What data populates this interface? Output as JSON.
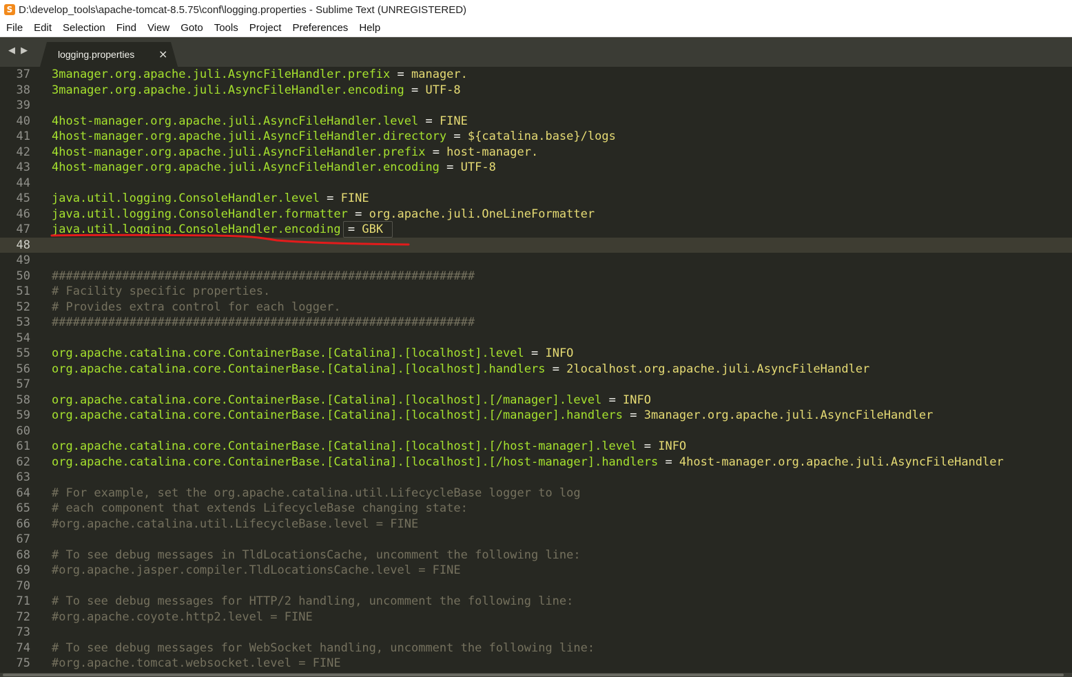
{
  "window": {
    "title": "D:\\develop_tools\\apache-tomcat-8.5.75\\conf\\logging.properties - Sublime Text (UNREGISTERED)",
    "app_icon": "S"
  },
  "menu": [
    "File",
    "Edit",
    "Selection",
    "Find",
    "View",
    "Goto",
    "Tools",
    "Project",
    "Preferences",
    "Help"
  ],
  "tabs": {
    "nav_back": "◀",
    "nav_forward": "▶",
    "active": {
      "label": "logging.properties",
      "close": "×"
    }
  },
  "editor": {
    "current_line": 48,
    "lines": [
      {
        "n": "37",
        "k": "3manager.org.apache.juli.AsyncFileHandler.prefix",
        "v": "manager."
      },
      {
        "n": "38",
        "k": "3manager.org.apache.juli.AsyncFileHandler.encoding",
        "v": "UTF-8"
      },
      {
        "n": "39"
      },
      {
        "n": "40",
        "k": "4host-manager.org.apache.juli.AsyncFileHandler.level",
        "v": "FINE"
      },
      {
        "n": "41",
        "k": "4host-manager.org.apache.juli.AsyncFileHandler.directory",
        "v": "${catalina.base}/logs"
      },
      {
        "n": "42",
        "k": "4host-manager.org.apache.juli.AsyncFileHandler.prefix",
        "v": "host-manager."
      },
      {
        "n": "43",
        "k": "4host-manager.org.apache.juli.AsyncFileHandler.encoding",
        "v": "UTF-8"
      },
      {
        "n": "44"
      },
      {
        "n": "45",
        "k": "java.util.logging.ConsoleHandler.level",
        "v": "FINE"
      },
      {
        "n": "46",
        "k": "java.util.logging.ConsoleHandler.formatter",
        "v": "org.apache.juli.OneLineFormatter"
      },
      {
        "n": "47",
        "k": "java.util.logging.ConsoleHandler.encoding",
        "v": "GBK",
        "highlight": true
      },
      {
        "n": "48"
      },
      {
        "n": "49"
      },
      {
        "n": "50",
        "c": "############################################################"
      },
      {
        "n": "51",
        "c": "# Facility specific properties."
      },
      {
        "n": "52",
        "c": "# Provides extra control for each logger."
      },
      {
        "n": "53",
        "c": "############################################################"
      },
      {
        "n": "54"
      },
      {
        "n": "55",
        "k": "org.apache.catalina.core.ContainerBase.[Catalina].[localhost].level",
        "v": "INFO"
      },
      {
        "n": "56",
        "k": "org.apache.catalina.core.ContainerBase.[Catalina].[localhost].handlers",
        "v": "2localhost.org.apache.juli.AsyncFileHandler"
      },
      {
        "n": "57"
      },
      {
        "n": "58",
        "k": "org.apache.catalina.core.ContainerBase.[Catalina].[localhost].[/manager].level",
        "v": "INFO"
      },
      {
        "n": "59",
        "k": "org.apache.catalina.core.ContainerBase.[Catalina].[localhost].[/manager].handlers",
        "v": "3manager.org.apache.juli.AsyncFileHandler"
      },
      {
        "n": "60"
      },
      {
        "n": "61",
        "k": "org.apache.catalina.core.ContainerBase.[Catalina].[localhost].[/host-manager].level",
        "v": "INFO"
      },
      {
        "n": "62",
        "k": "org.apache.catalina.core.ContainerBase.[Catalina].[localhost].[/host-manager].handlers",
        "v": "4host-manager.org.apache.juli.AsyncFileHandler"
      },
      {
        "n": "63"
      },
      {
        "n": "64",
        "c": "# For example, set the org.apache.catalina.util.LifecycleBase logger to log"
      },
      {
        "n": "65",
        "c": "# each component that extends LifecycleBase changing state:"
      },
      {
        "n": "66",
        "c": "#org.apache.catalina.util.LifecycleBase.level = FINE"
      },
      {
        "n": "67"
      },
      {
        "n": "68",
        "c": "# To see debug messages in TldLocationsCache, uncomment the following line:"
      },
      {
        "n": "69",
        "c": "#org.apache.jasper.compiler.TldLocationsCache.level = FINE"
      },
      {
        "n": "70"
      },
      {
        "n": "71",
        "c": "# To see debug messages for HTTP/2 handling, uncomment the following line:"
      },
      {
        "n": "72",
        "c": "#org.apache.coyote.http2.level = FINE"
      },
      {
        "n": "73"
      },
      {
        "n": "74",
        "c": "# To see debug messages for WebSocket handling, uncomment the following line:"
      },
      {
        "n": "75",
        "c": "#org.apache.tomcat.websocket.level = FINE"
      }
    ]
  },
  "colors": {
    "background": "#272822",
    "key": "#a6e22e",
    "value": "#e6db74",
    "comment": "#75715e",
    "annotation": "#e31b1b"
  }
}
